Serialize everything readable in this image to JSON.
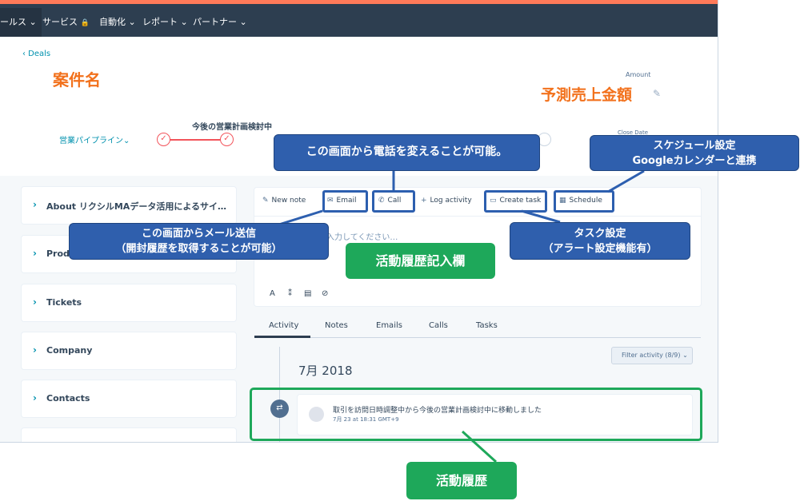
{
  "nav": {
    "items": [
      "ールス",
      "サービス",
      "自動化",
      "レポート",
      "パートナー"
    ],
    "lock_icon": "lock-icon"
  },
  "deal": {
    "back_link": "‹ Deals",
    "name": "案件名",
    "amount_label": "Amount",
    "amount_value": "予測売上金額",
    "stage_label": "今後の営業計画検討中",
    "pipeline": "営業パイプライン",
    "close_date_label": "Close Date"
  },
  "left_cards": [
    "About リクシルMAデータ活用によるサイ…",
    "Produ",
    "Tickets",
    "Company",
    "Contacts"
  ],
  "activity_bar": {
    "new_note": "New note",
    "email": "Email",
    "call": "Call",
    "log_activity": "Log activity",
    "create_task": "Create task",
    "schedule": "Schedule"
  },
  "editor": {
    "placeholder": "は入力してください…"
  },
  "subtabs": [
    "Activity",
    "Notes",
    "Emails",
    "Calls",
    "Tasks"
  ],
  "filter": "Filter activity (8/9)",
  "timeline": {
    "month": "7月 2018",
    "activity_text": "取引を訪問日時調整中から今後の営業計画検討中に移動しました",
    "activity_time": "7月 23 at 18:31 GMT+9"
  },
  "callouts": {
    "call": "この画面から電話を変えることが可能。",
    "schedule_line1": "スケジュール設定",
    "schedule_line2": "Googleカレンダーと連携",
    "email_line1": "この画面からメール送信",
    "email_line2": "（開封履歴を取得することが可能）",
    "task_line1": "タスク設定",
    "task_line2": "（アラート設定機能有）",
    "entry": "活動履歴記入欄",
    "history": "活動履歴"
  },
  "colors": {
    "nav_bg": "#2d3e50",
    "accent": "#f2711c",
    "callout_blue": "#2f5fad",
    "callout_green": "#1ea85a",
    "link": "#0091ae"
  }
}
